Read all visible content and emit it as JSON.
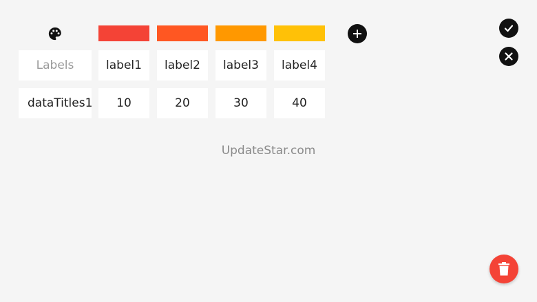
{
  "palette": {
    "icon": "palette-icon"
  },
  "swatches": [
    {
      "color": "#f44336"
    },
    {
      "color": "#ff5722"
    },
    {
      "color": "#ff9800"
    },
    {
      "color": "#ffc107"
    }
  ],
  "add_button": {
    "icon": "plus-icon"
  },
  "confirm_button": {
    "icon": "check-icon"
  },
  "cancel_button": {
    "icon": "close-icon"
  },
  "labels_row": {
    "header_placeholder": "Labels",
    "values": [
      "label1",
      "label2",
      "label3",
      "label4"
    ]
  },
  "data_row": {
    "title": "dataTitles1",
    "values": [
      "10",
      "20",
      "30",
      "40"
    ]
  },
  "watermark": "UpdateStar.com",
  "delete_button": {
    "icon": "trash-icon",
    "color": "#f44336"
  }
}
